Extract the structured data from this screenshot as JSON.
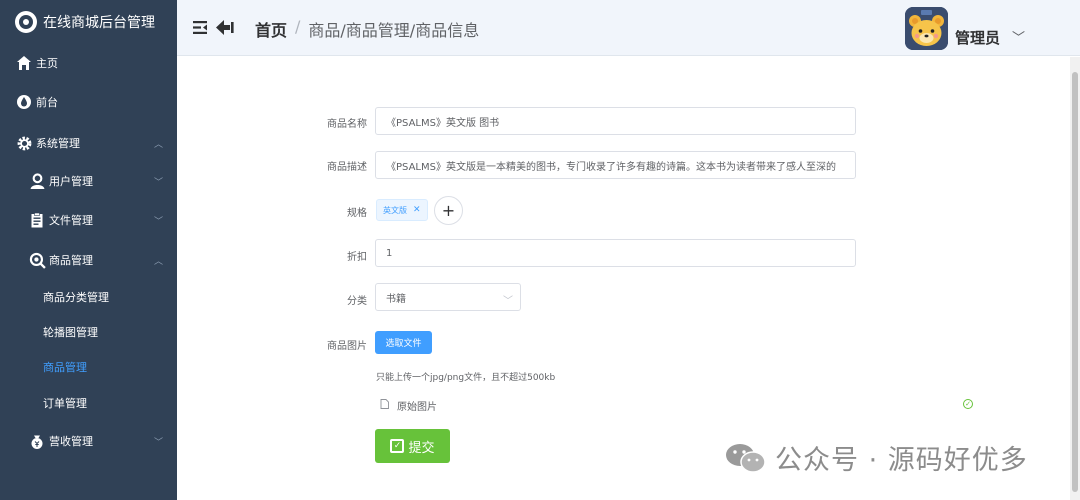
{
  "app": {
    "title": "在线商城后台管理"
  },
  "sidebar": {
    "items": [
      {
        "label": "主页",
        "icon": "home-icon"
      },
      {
        "label": "前台",
        "icon": "drop-icon"
      },
      {
        "label": "系统管理",
        "icon": "gear-icon"
      },
      {
        "label": "用户管理",
        "icon": "user-icon"
      },
      {
        "label": "文件管理",
        "icon": "file-icon"
      },
      {
        "label": "商品管理",
        "icon": "search-product-icon"
      },
      {
        "label": "商品分类管理"
      },
      {
        "label": "轮播图管理"
      },
      {
        "label": "商品管理"
      },
      {
        "label": "订单管理"
      },
      {
        "label": "营收管理",
        "icon": "money-icon"
      }
    ]
  },
  "header": {
    "breadcrumb_home": "首页",
    "breadcrumb_sep": "/",
    "breadcrumb_path": "商品/商品管理/商品信息",
    "user_name": "管理员"
  },
  "form": {
    "name_label": "商品名称",
    "name_value": "《PSALMS》英文版 图书",
    "desc_label": "商品描述",
    "desc_value": "《PSALMS》英文版是一本精美的图书，专门收录了许多有趣的诗篇。这本书为读者带来了感人至深的",
    "spec_label": "规格",
    "spec_tag": "英文版",
    "discount_label": "折扣",
    "discount_value": "1",
    "category_label": "分类",
    "category_value": "书籍",
    "image_label": "商品图片",
    "file_button": "选取文件",
    "upload_tip": "只能上传一个jpg/png文件，且不超过500kb",
    "file_name": "原始图片",
    "submit_label": "提交"
  },
  "watermark": {
    "text": "公众号 · 源码好优多"
  },
  "colors": {
    "sidebar": "#304156",
    "accent": "#409eff",
    "success": "#67c23a"
  }
}
